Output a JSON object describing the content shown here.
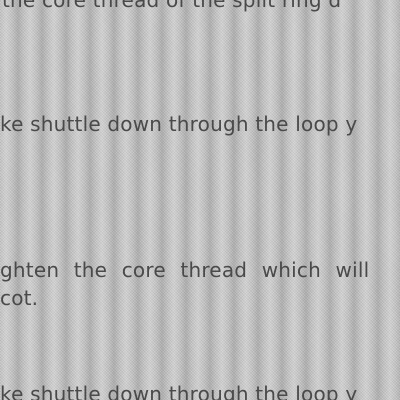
{
  "document": {
    "lines": [
      "the core thread of the split ring d",
      "ke shuttle down through the loop y",
      "ghten the core thread which will",
      "cot.",
      "ke shuttle down through the loop y"
    ]
  }
}
